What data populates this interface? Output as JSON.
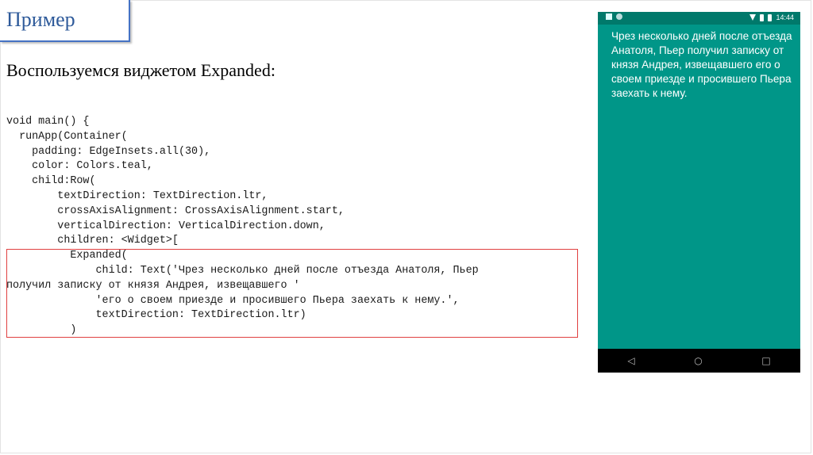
{
  "slide": {
    "title": "Пример",
    "subtitle": "Воспользуемся виджетом Expanded:"
  },
  "code": {
    "lines": [
      "void main() {",
      "  runApp(Container(",
      "    padding: EdgeInsets.all(30),",
      "    color: Colors.teal,",
      "    child:Row(",
      "        textDirection: TextDirection.ltr,",
      "        crossAxisAlignment: CrossAxisAlignment.start,",
      "        verticalDirection: VerticalDirection.down,",
      "        children: <Widget>[",
      "          Expanded(",
      "              child: Text('Чрез несколько дней после отъезда Анатоля, Пьер",
      "получил записку от князя Андрея, извещавшего '",
      "              'его о своем приезде и просившего Пьера заехать к нему.',",
      "              textDirection: TextDirection.ltr)",
      "          )"
    ]
  },
  "phone": {
    "time": "14:44",
    "text": "Чрез несколько дней после отъезда Анатоля, Пьер получил записку от князя Андрея, извещавшего его о своем приезде и просившего Пьера заехать к нему.",
    "background_color": "#009688",
    "nav": {
      "back": "◁",
      "home": "○",
      "recents": "□"
    }
  }
}
